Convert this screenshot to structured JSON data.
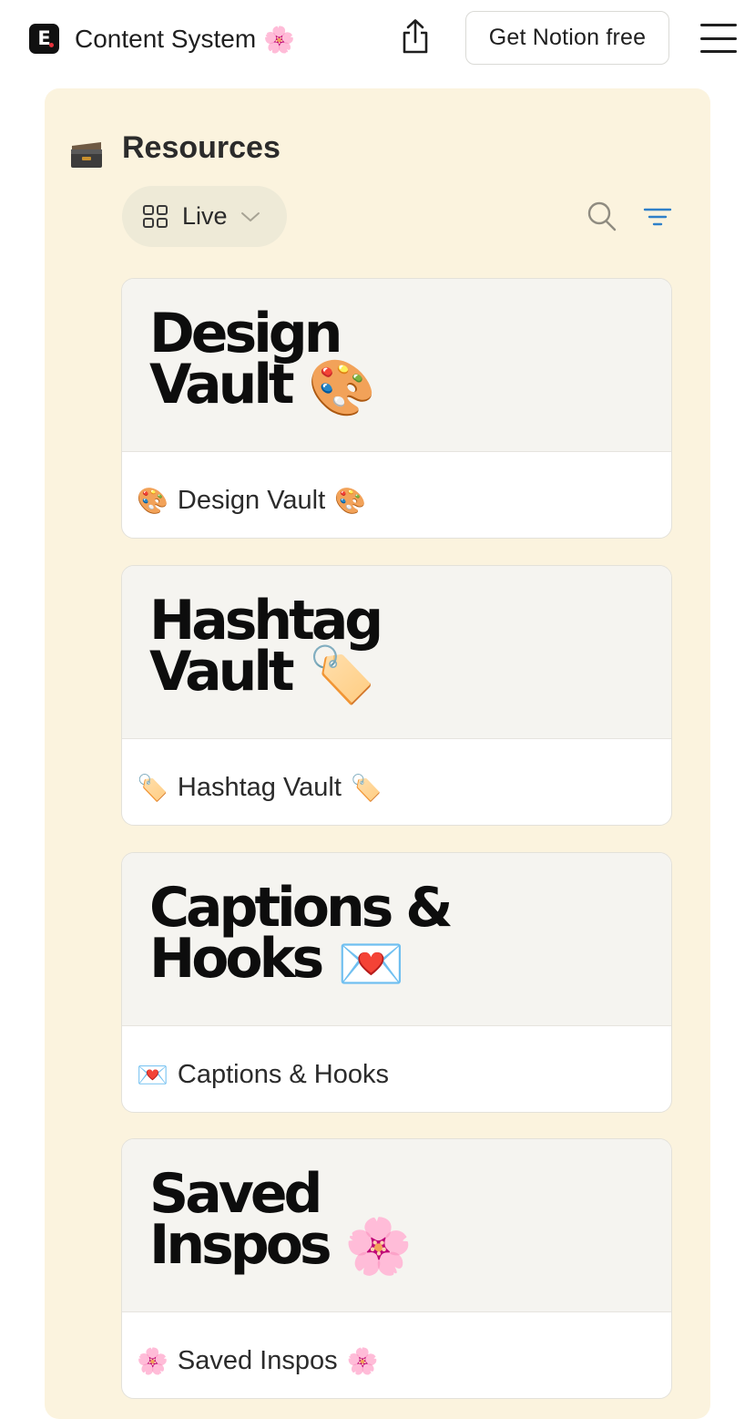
{
  "topbar": {
    "workspace_title": "Content System",
    "workspace_emoji": "🌸",
    "get_button": "Get Notion free"
  },
  "database": {
    "title": "Resources",
    "icon": "card-file-box-icon",
    "view_label": "Live"
  },
  "cards": [
    {
      "cover_line1": "Design",
      "cover_line2": "Vault",
      "cover_emoji": "🎨",
      "emoji": "🎨",
      "title": "Design Vault",
      "emoji_after": "🎨"
    },
    {
      "cover_line1": "Hashtag",
      "cover_line2": "Vault",
      "cover_emoji": "🏷️",
      "emoji": "🏷️",
      "title": "Hashtag Vault",
      "emoji_after": "🏷️"
    },
    {
      "cover_line1": "Captions &",
      "cover_line2": "Hooks",
      "cover_emoji": "💌",
      "emoji": "💌",
      "title": "Captions & Hooks",
      "emoji_after": ""
    },
    {
      "cover_line1": "Saved",
      "cover_line2": "Inspos",
      "cover_emoji": "🌸",
      "emoji": "🌸",
      "title": "Saved Inspos",
      "emoji_after": "🌸"
    }
  ],
  "colors": {
    "callout_bg": "#fbf3de",
    "view_tab_bg": "#eeead7",
    "filter_accent": "#2f80c9"
  }
}
